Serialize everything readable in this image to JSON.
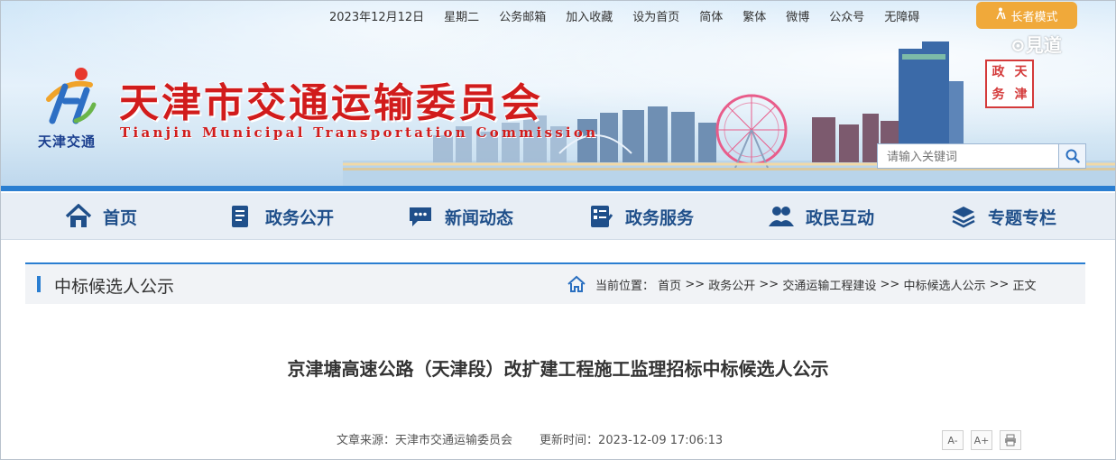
{
  "top_bar": {
    "date": "2023年12月12日",
    "weekday": "星期二",
    "links": [
      "公务邮箱",
      "加入收藏",
      "设为首页",
      "简体",
      "繁体",
      "微博",
      "公众号",
      "无障碍"
    ],
    "elder_mode": "长者模式",
    "watermark": "⊙見道"
  },
  "header": {
    "logo_text": "天津交通",
    "title": "天津市交通运输委员会",
    "subtitle": "Tianjin Municipal Transportation Commission",
    "seal_chars": [
      "政",
      "天",
      "务",
      "津"
    ],
    "search_placeholder": "请输入关键词"
  },
  "nav": {
    "items": [
      {
        "label": "首页",
        "icon": "home-icon"
      },
      {
        "label": "政务公开",
        "icon": "document-icon"
      },
      {
        "label": "新闻动态",
        "icon": "chat-icon"
      },
      {
        "label": "政务服务",
        "icon": "service-icon"
      },
      {
        "label": "政民互动",
        "icon": "users-icon"
      },
      {
        "label": "专题专栏",
        "icon": "layers-icon"
      }
    ]
  },
  "section": {
    "title": "中标候选人公示",
    "breadcrumb_label": "当前位置：",
    "breadcrumb": [
      "首页",
      "政务公开",
      "交通运输工程建设",
      "中标候选人公示",
      "正文"
    ],
    "separator": ">>"
  },
  "article": {
    "title": "京津塘高速公路（天津段）改扩建工程施工监理招标中标候选人公示",
    "source_label": "文章来源：",
    "source": "天津市交通运输委员会",
    "updated_label": "更新时间：",
    "updated": "2023-12-09 17:06:13",
    "tools": [
      "A-",
      "A+"
    ]
  },
  "colors": {
    "accent": "#2a7ed1",
    "title_red": "#d11c1c",
    "nav_text": "#1f4f8a",
    "elder_orange": "#f0a93a"
  }
}
